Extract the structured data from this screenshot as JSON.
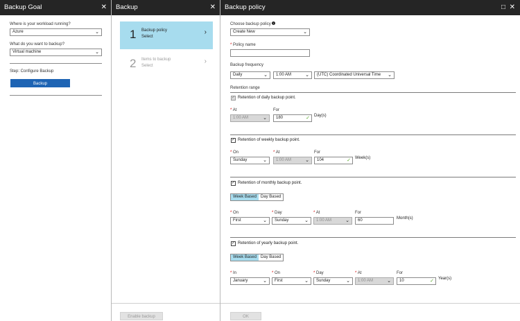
{
  "blade1": {
    "title": "Backup Goal",
    "close_icon": "✕",
    "workload_label": "Where is your workload running?",
    "workload_value": "Azure",
    "backup_what_label": "What do you want to backup?",
    "backup_what_value": "Virtual machine",
    "step_label": "Step: Configure Backup",
    "backup_button": "Backup",
    "chevron": "⌄"
  },
  "blade2": {
    "title": "Backup",
    "close_icon": "✕",
    "steps": [
      {
        "num": "1",
        "title": "Backup policy",
        "sub": "Select",
        "arrow": "›"
      },
      {
        "num": "2",
        "title": "Items to backup",
        "sub": "Select",
        "arrow": "›"
      }
    ],
    "enable_button": "Enable backup"
  },
  "blade3": {
    "title": "Backup policy",
    "maximize_icon": "□",
    "close_icon": "✕",
    "choose_policy_label": "Choose backup policy",
    "info_icon": "i",
    "choose_policy_value": "Create New",
    "required_mark": "*",
    "policy_name_label": "Policy name",
    "policy_name_value": "",
    "frequency_label": "Backup frequency",
    "frequency_value": "Daily",
    "frequency_time": "1:00 AM",
    "timezone": "(UTC) Coordinated Universal Time",
    "retention_range_label": "Retention range",
    "check_mark": "✓",
    "daily": {
      "label": "Retention of daily backup point.",
      "at_label": "At",
      "at_value": "1:00 AM",
      "for_label": "For",
      "for_value": "180",
      "unit": "Day(s)"
    },
    "weekly": {
      "label": "Retention of weekly backup point.",
      "on_label": "On",
      "on_value": "Sunday",
      "at_label": "At",
      "at_value": "1:00 AM",
      "for_label": "For",
      "for_value": "104",
      "unit": "Week(s)"
    },
    "monthly": {
      "label": "Retention of monthly backup point.",
      "seg_week": "Week Based",
      "seg_day": "Day Based",
      "on_label": "On",
      "on_value": "First",
      "day_label": "Day",
      "day_value": "Sunday",
      "at_label": "At",
      "at_value": "1:00 AM",
      "for_label": "For",
      "for_value": "60",
      "unit": "Month(s)"
    },
    "yearly": {
      "label": "Retention of yearly backup point.",
      "seg_week": "Week Based",
      "seg_day": "Day Based",
      "in_label": "In",
      "in_value": "January",
      "on_label": "On",
      "on_value": "First",
      "day_label": "Day",
      "day_value": "Sunday",
      "at_label": "At",
      "at_value": "1:00 AM",
      "for_label": "For",
      "for_value": "10",
      "unit": "Year(s)"
    },
    "ok_button": "OK"
  },
  "colors": {
    "header_bg": "#252525",
    "accent_blue": "#1e64b4",
    "selected_step": "#a7dcee",
    "required_red": "#d10000",
    "valid_green": "#5aaa2a"
  }
}
